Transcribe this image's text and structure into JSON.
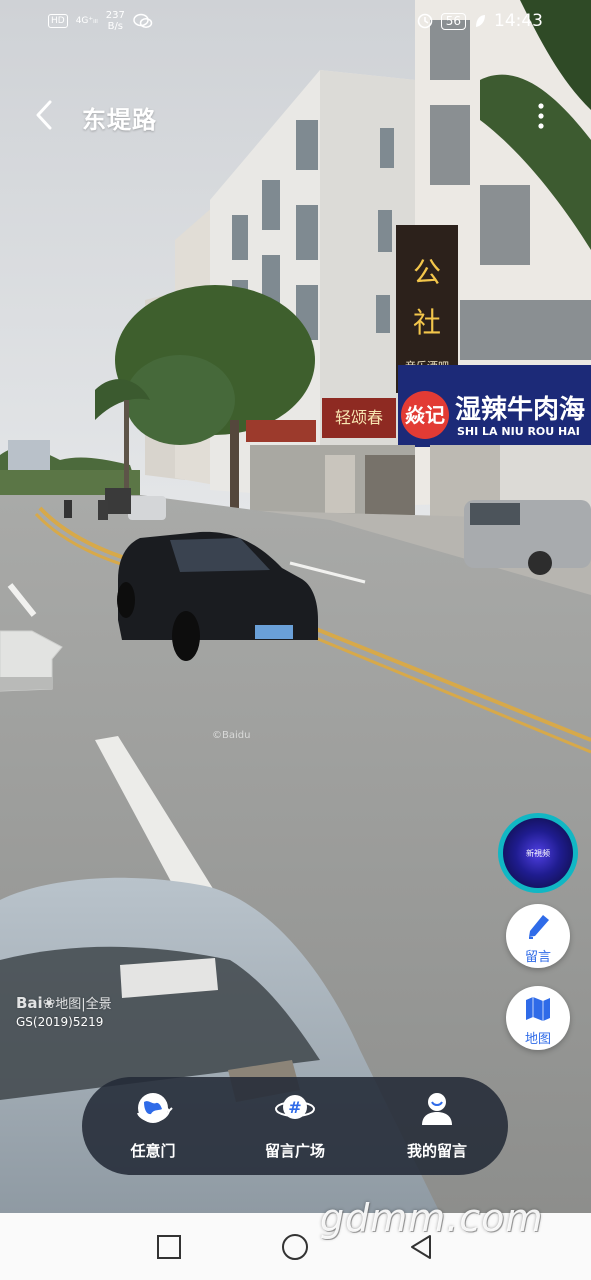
{
  "status_bar": {
    "hd_badge": "HD",
    "signal": "4G⁺ᵢₗₗ",
    "net_speed": "237\nB/s",
    "battery": "56",
    "time": "14:43"
  },
  "header": {
    "title": "东堤路"
  },
  "street_signs": {
    "shop_a_top": "公",
    "shop_a_mid": "社",
    "shop_a_sub": "音乐酒吧",
    "shop_b_name": "湿辣牛肉海",
    "shop_b_brand": "焱记",
    "shop_b_pinyin": "SHI LA NIU ROU HAI",
    "shop_c": "轻颂春"
  },
  "floating_buttons": {
    "orb_text": "新視频",
    "comment_label": "留言",
    "map_label": "地图"
  },
  "watermark": {
    "brand": "Bai",
    "brand_suffix": "地图|全景",
    "code": "GS(2019)5219",
    "center": "©Baidu"
  },
  "action_bar": {
    "items": [
      {
        "label": "任意门",
        "icon": "globe-portal-icon"
      },
      {
        "label": "留言广场",
        "icon": "hashtag-planet-icon"
      },
      {
        "label": "我的留言",
        "icon": "user-icon"
      }
    ]
  },
  "site_watermark": "gdmm.com",
  "colors": {
    "accent_blue": "#2f6be8",
    "orb_ring": "#11b7c4",
    "action_bar_bg": "#232a37"
  }
}
